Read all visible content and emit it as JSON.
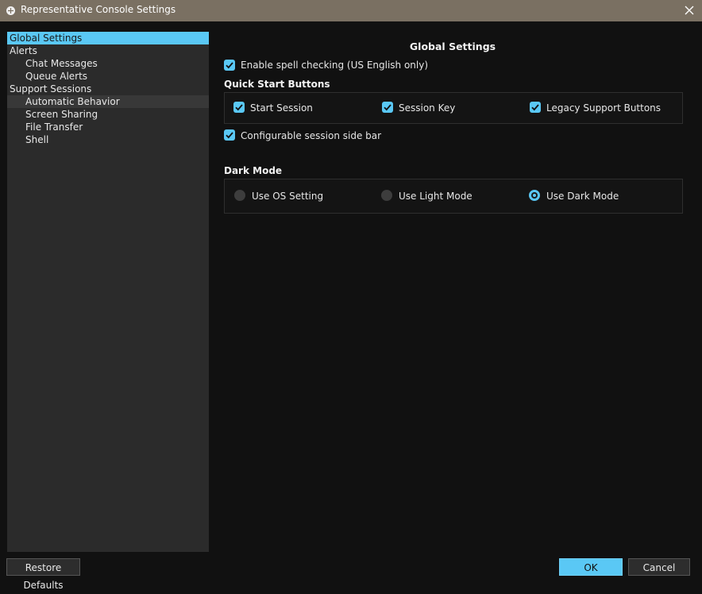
{
  "window": {
    "title": "Representative Console Settings"
  },
  "tree": [
    {
      "label": "Global Settings"
    },
    {
      "label": "Alerts"
    },
    {
      "label": "Chat Messages"
    },
    {
      "label": "Queue Alerts"
    },
    {
      "label": "Support Sessions"
    },
    {
      "label": "Automatic Behavior"
    },
    {
      "label": "Screen Sharing"
    },
    {
      "label": "File Transfer"
    },
    {
      "label": "Shell"
    }
  ],
  "content": {
    "title": "Global Settings",
    "spell_check": {
      "label": "Enable spell checking (US English only)",
      "checked": true
    },
    "quick_start": {
      "heading": "Quick Start Buttons",
      "options": [
        {
          "label": "Start Session",
          "checked": true
        },
        {
          "label": "Session Key",
          "checked": true
        },
        {
          "label": "Legacy Support Buttons",
          "checked": true
        }
      ]
    },
    "sidebar_option": {
      "label": "Configurable session side bar",
      "checked": true
    },
    "dark_mode": {
      "heading": "Dark Mode",
      "options": [
        {
          "label": "Use OS Setting",
          "selected": false
        },
        {
          "label": "Use Light Mode",
          "selected": false
        },
        {
          "label": "Use Dark Mode",
          "selected": true
        }
      ]
    }
  },
  "buttons": {
    "restore_defaults": "Restore Defaults",
    "ok": "OK",
    "cancel": "Cancel"
  },
  "colors": {
    "accent": "#5ac8f5",
    "titlebar": "#7a7062",
    "background": "#111111",
    "tree_background": "#2b2b2b"
  }
}
